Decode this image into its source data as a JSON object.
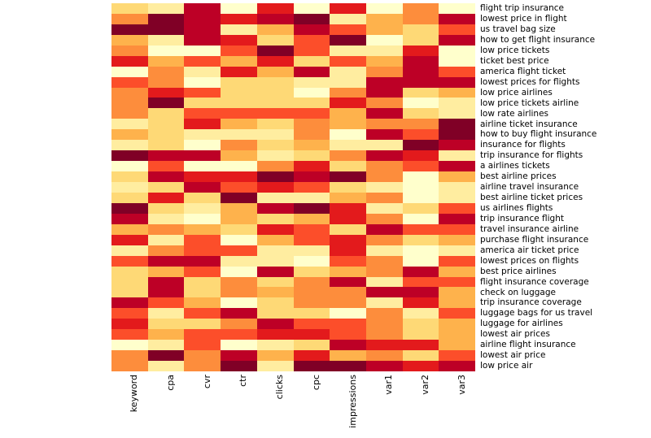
{
  "chart_data": {
    "type": "heatmap",
    "title": "",
    "xlabel": "",
    "ylabel": "",
    "grid": false,
    "legend_position": "none",
    "color_scale": {
      "name": "YlOrRd",
      "levels": [
        "#ffffcc",
        "#ffeda0",
        "#fed976",
        "#feb24c",
        "#fd8d3c",
        "#fc4e2a",
        "#e31a1c",
        "#bd0026",
        "#800026"
      ],
      "low": "#ffffcc",
      "high": "#800026"
    },
    "columns": [
      "keyword",
      "cpa",
      "cvr",
      "ctr",
      "clicks",
      "cpc",
      "impressions",
      "var1",
      "var2",
      "var3"
    ],
    "rows": [
      "flight trip insurance",
      "lowest price in flight",
      "us travel bag size",
      "how to get flight insurance",
      "low price tickets",
      "ticket best price",
      "america flight ticket",
      "lowest prices for flights",
      "low price airlines",
      "low price tickets airline",
      "low rate airlines",
      "airline ticket insurance",
      "how to buy flight insurance",
      "insurance for flights",
      "trip insurance for flights",
      "a airlines tickets",
      "best airline prices",
      "airline travel insurance",
      "best airline ticket prices",
      "us airlines flights",
      "trip insurance flight",
      "travel insurance airline",
      "purchase flight insurance",
      "america air ticket price",
      "lowest prices on flights",
      "best price airlines",
      "flight insurance coverage",
      "check on luggage",
      "trip insurance coverage",
      "luggage bags for us travel",
      "luggage for airlines",
      "lowest air prices",
      "airline flight insurance",
      "lowest air price",
      "low price air"
    ],
    "values": [
      [
        3,
        2,
        8,
        1,
        7,
        1,
        7,
        1,
        5,
        1
      ],
      [
        5,
        9,
        8,
        7,
        8,
        9,
        2,
        4,
        5,
        8
      ],
      [
        9,
        9,
        8,
        2,
        4,
        8,
        6,
        4,
        3,
        6
      ],
      [
        4,
        2,
        8,
        7,
        3,
        6,
        9,
        1,
        3,
        8
      ],
      [
        5,
        1,
        1,
        6,
        9,
        6,
        2,
        2,
        7,
        1
      ],
      [
        7,
        4,
        6,
        4,
        7,
        3,
        6,
        4,
        8,
        1
      ],
      [
        1,
        5,
        2,
        7,
        4,
        8,
        2,
        5,
        8,
        6
      ],
      [
        6,
        5,
        1,
        3,
        3,
        2,
        2,
        8,
        8,
        8
      ],
      [
        5,
        7,
        6,
        3,
        3,
        1,
        5,
        8,
        3,
        4
      ],
      [
        5,
        9,
        3,
        3,
        3,
        3,
        7,
        5,
        1,
        2
      ],
      [
        5,
        3,
        6,
        6,
        6,
        6,
        4,
        8,
        3,
        2
      ],
      [
        2,
        3,
        7,
        4,
        3,
        5,
        4,
        5,
        5,
        9
      ],
      [
        4,
        3,
        2,
        2,
        2,
        5,
        1,
        8,
        6,
        9
      ],
      [
        2,
        3,
        1,
        5,
        3,
        4,
        2,
        2,
        9,
        8
      ],
      [
        9,
        8,
        8,
        4,
        2,
        3,
        5,
        8,
        7,
        2
      ],
      [
        1,
        6,
        1,
        1,
        5,
        7,
        3,
        5,
        6,
        8
      ],
      [
        3,
        8,
        7,
        7,
        9,
        8,
        9,
        5,
        1,
        4
      ],
      [
        2,
        3,
        8,
        6,
        7,
        6,
        3,
        2,
        1,
        2
      ],
      [
        3,
        7,
        3,
        9,
        2,
        2,
        4,
        5,
        1,
        2
      ],
      [
        9,
        3,
        2,
        4,
        8,
        9,
        7,
        2,
        3,
        6
      ],
      [
        8,
        2,
        1,
        4,
        3,
        4,
        7,
        5,
        1,
        8
      ],
      [
        4,
        5,
        4,
        3,
        7,
        6,
        3,
        8,
        6,
        6
      ],
      [
        7,
        2,
        6,
        1,
        4,
        6,
        7,
        5,
        3,
        4
      ],
      [
        2,
        5,
        6,
        6,
        2,
        2,
        7,
        2,
        1,
        2
      ],
      [
        6,
        8,
        8,
        2,
        2,
        1,
        6,
        5,
        1,
        6
      ],
      [
        3,
        4,
        6,
        1,
        8,
        3,
        4,
        5,
        8,
        4
      ],
      [
        3,
        8,
        3,
        5,
        3,
        5,
        8,
        2,
        6,
        6
      ],
      [
        3,
        8,
        3,
        5,
        4,
        5,
        5,
        8,
        8,
        4
      ],
      [
        8,
        6,
        4,
        1,
        3,
        5,
        5,
        2,
        7,
        4
      ],
      [
        6,
        2,
        6,
        8,
        3,
        3,
        1,
        5,
        2,
        6
      ],
      [
        7,
        3,
        3,
        5,
        8,
        6,
        6,
        5,
        3,
        4
      ],
      [
        6,
        4,
        6,
        6,
        7,
        7,
        6,
        5,
        3,
        4
      ],
      [
        1,
        2,
        6,
        1,
        2,
        3,
        8,
        7,
        7,
        4
      ],
      [
        5,
        9,
        5,
        8,
        4,
        7,
        4,
        5,
        3,
        6
      ],
      [
        5,
        2,
        5,
        9,
        2,
        9,
        9,
        8,
        7,
        8
      ]
    ]
  }
}
